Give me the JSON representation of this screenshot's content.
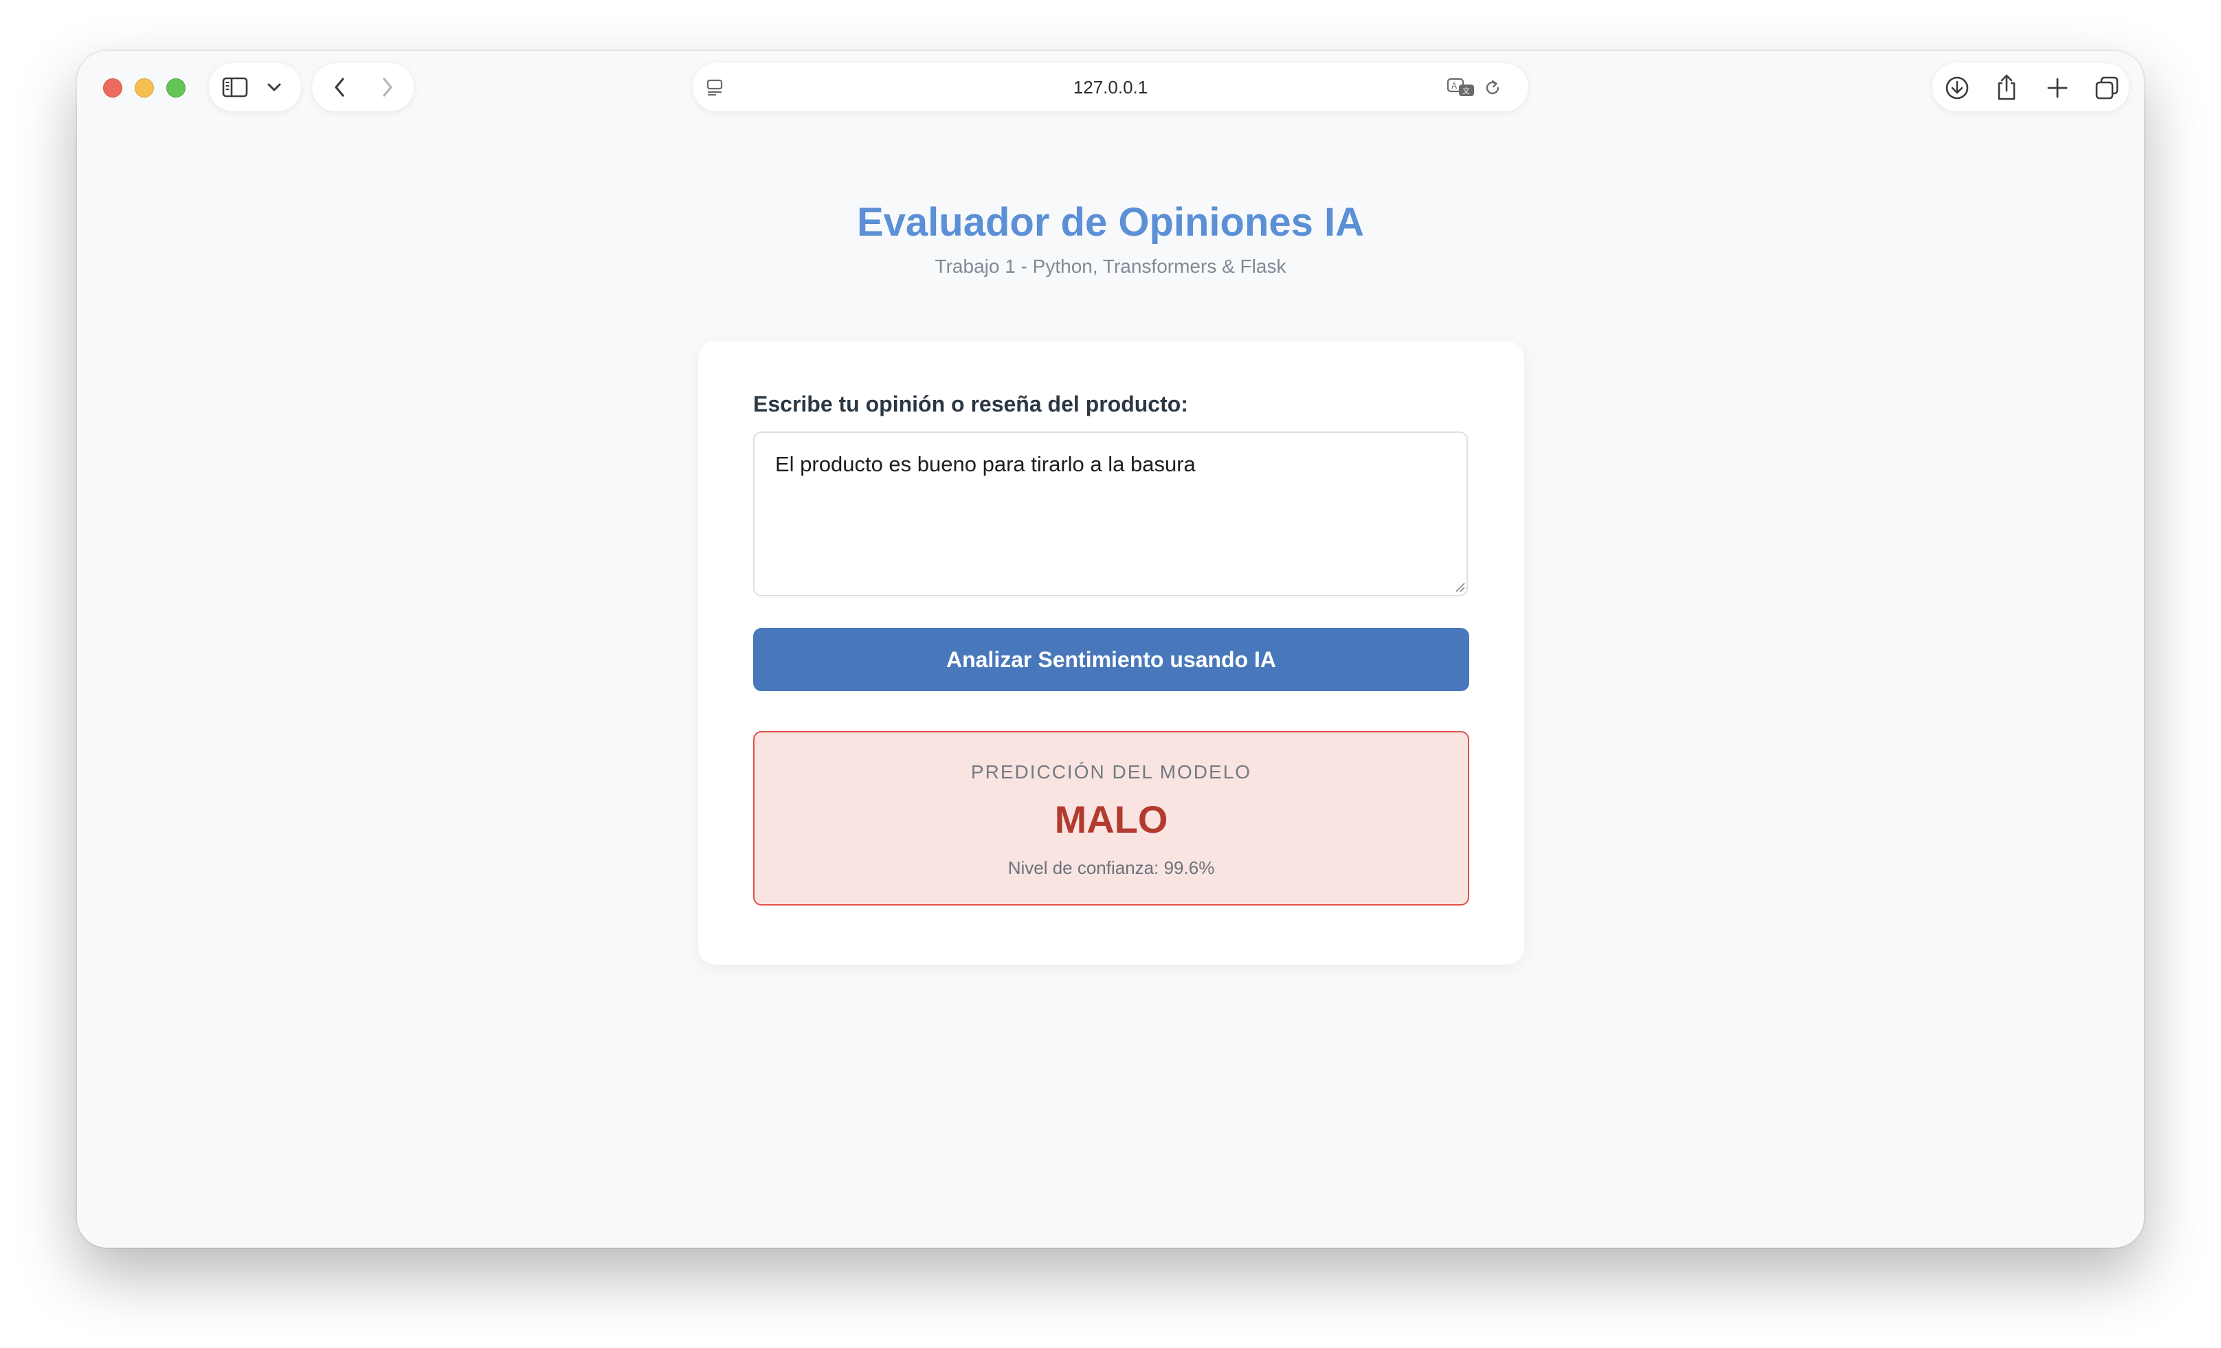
{
  "browser": {
    "url": "127.0.0.1",
    "traffic_lights": {
      "close": "#ed6a5e",
      "minimize": "#f5bf4f",
      "zoom": "#62c554"
    },
    "icons": {
      "sidebar": "sidebar-icon",
      "dropdown": "chevron-down-icon",
      "back": "chevron-left-icon",
      "forward": "chevron-right-icon",
      "page": "page-menu-icon",
      "translate": "translate-icon",
      "reload": "reload-icon",
      "download": "download-icon",
      "share": "share-icon",
      "new_tab": "plus-icon",
      "tabs": "tabs-overview-icon"
    }
  },
  "header": {
    "title": "Evaluador de Opiniones IA",
    "subtitle": "Trabajo 1 - Python, Transformers & Flask"
  },
  "form": {
    "label": "Escribe tu opinión o reseña del producto:",
    "review_value": "El producto es bueno para tirarlo a la basura",
    "submit_label": "Analizar Sentimiento usando IA"
  },
  "result": {
    "heading": "PREDICCIÓN DEL MODELO",
    "prediction": "MALO",
    "confidence": "Nivel de confianza: 99.6%"
  },
  "colors": {
    "title": "#5b8fd6",
    "button": "#4878bb",
    "result_bg": "#f9e4e2",
    "result_border": "#e1504a",
    "result_text": "#b23a2e"
  }
}
